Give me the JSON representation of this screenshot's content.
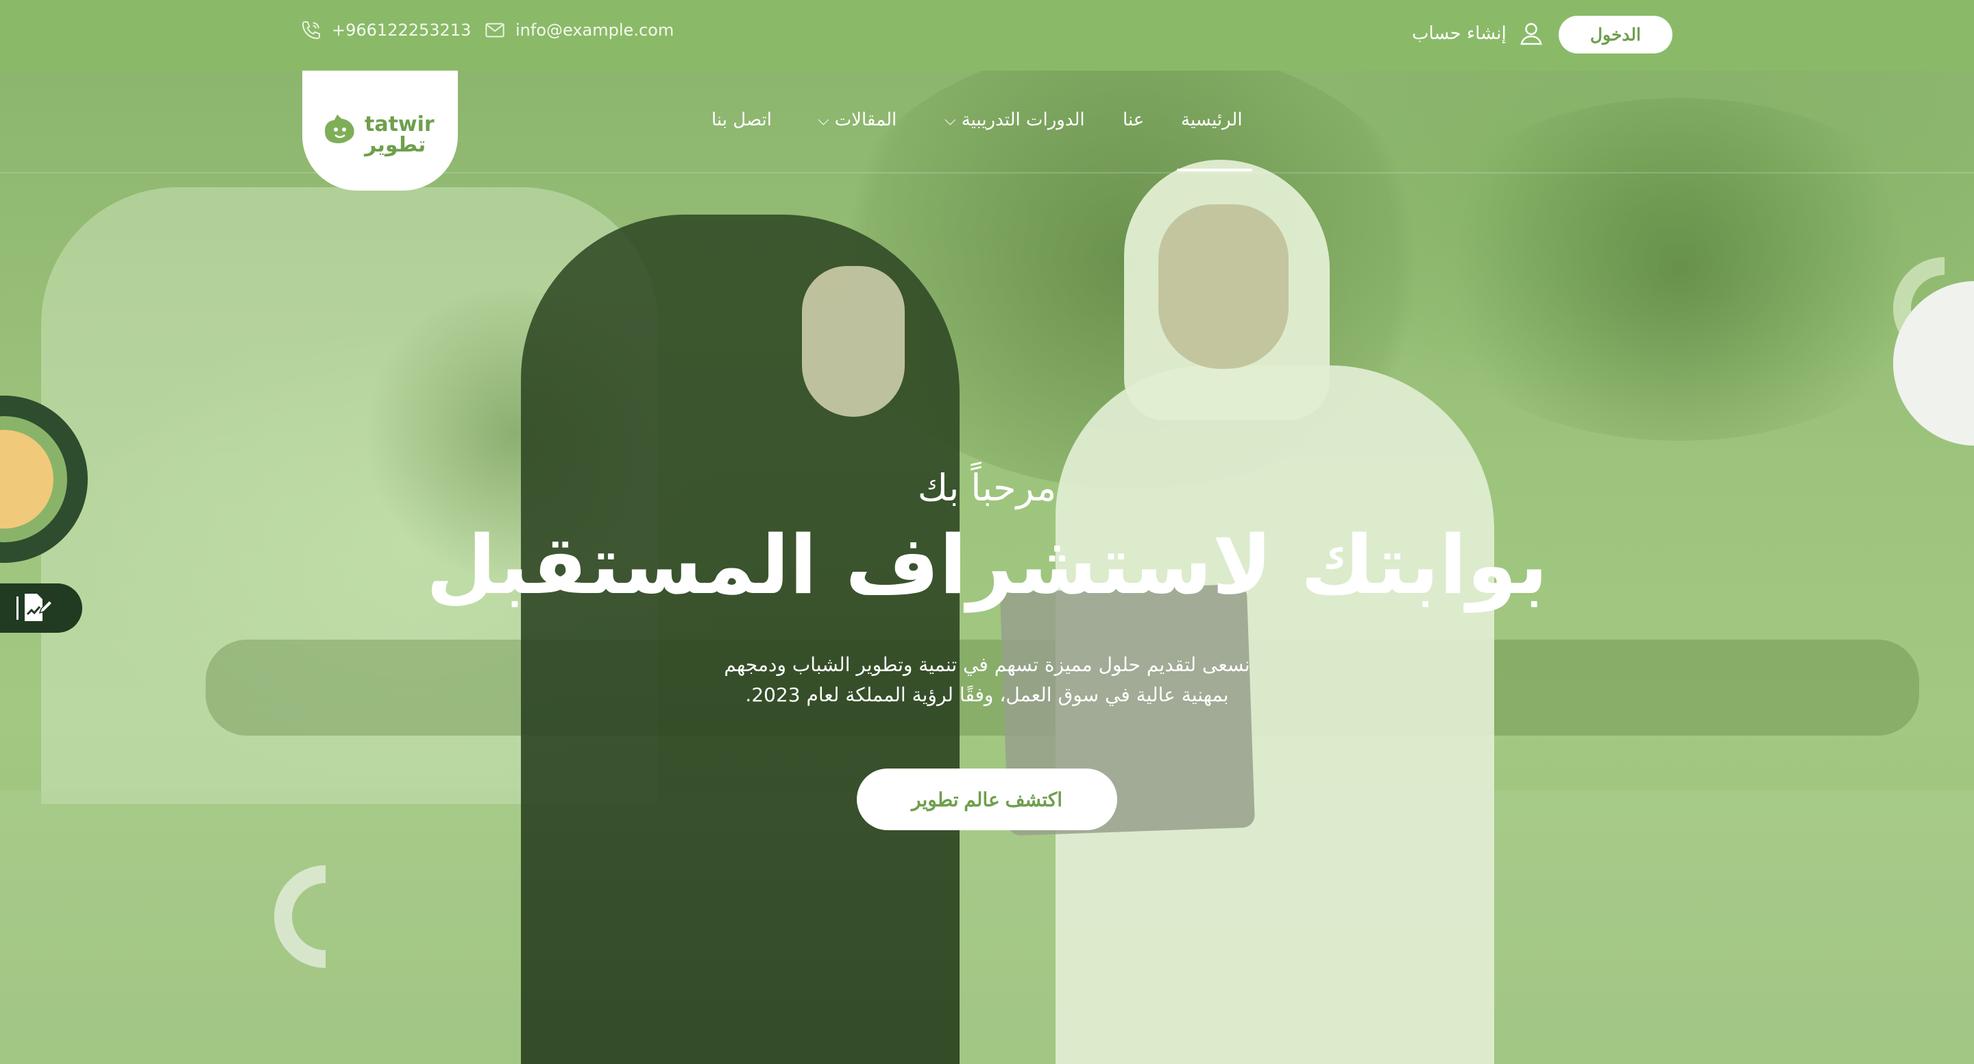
{
  "topbar": {
    "phone": "+966122253213",
    "email": "info@example.com",
    "login_label": "الدخول",
    "register_label": "إنشاء حساب"
  },
  "logo": {
    "latin": "tatwir",
    "arabic": "تطوير"
  },
  "nav": {
    "items": [
      {
        "label": "الرئيسية",
        "active": true
      },
      {
        "label": "عنا"
      },
      {
        "label": "الدورات التدريبية",
        "dropdown": true
      },
      {
        "label": "المقالات",
        "dropdown": true
      },
      {
        "label": "اتصل بنا"
      }
    ]
  },
  "hero": {
    "welcome": "مرحباً بك",
    "headline": "بوابتك لاستشراف المستقبل",
    "description_line1": "نسعى لتقديم حلول مميزة تسهم في تنمية وتطوير الشباب ودمجهم",
    "description_line2": "بمهنية عالية في سوق العمل، وفقًا لرؤية المملكة لعام 2023.",
    "cta_label": "اكتشف عالم تطوير"
  },
  "colors": {
    "brand_green": "#8aba68",
    "button_text": "#6f9f4d",
    "dark_green": "#213a22",
    "accent_yellow": "#f1c97a"
  },
  "icons": {
    "phone": "phone-icon",
    "email": "envelope-icon",
    "user": "user-icon",
    "chevron": "chevron-down-icon",
    "side_tab": "edit-document-icon"
  }
}
